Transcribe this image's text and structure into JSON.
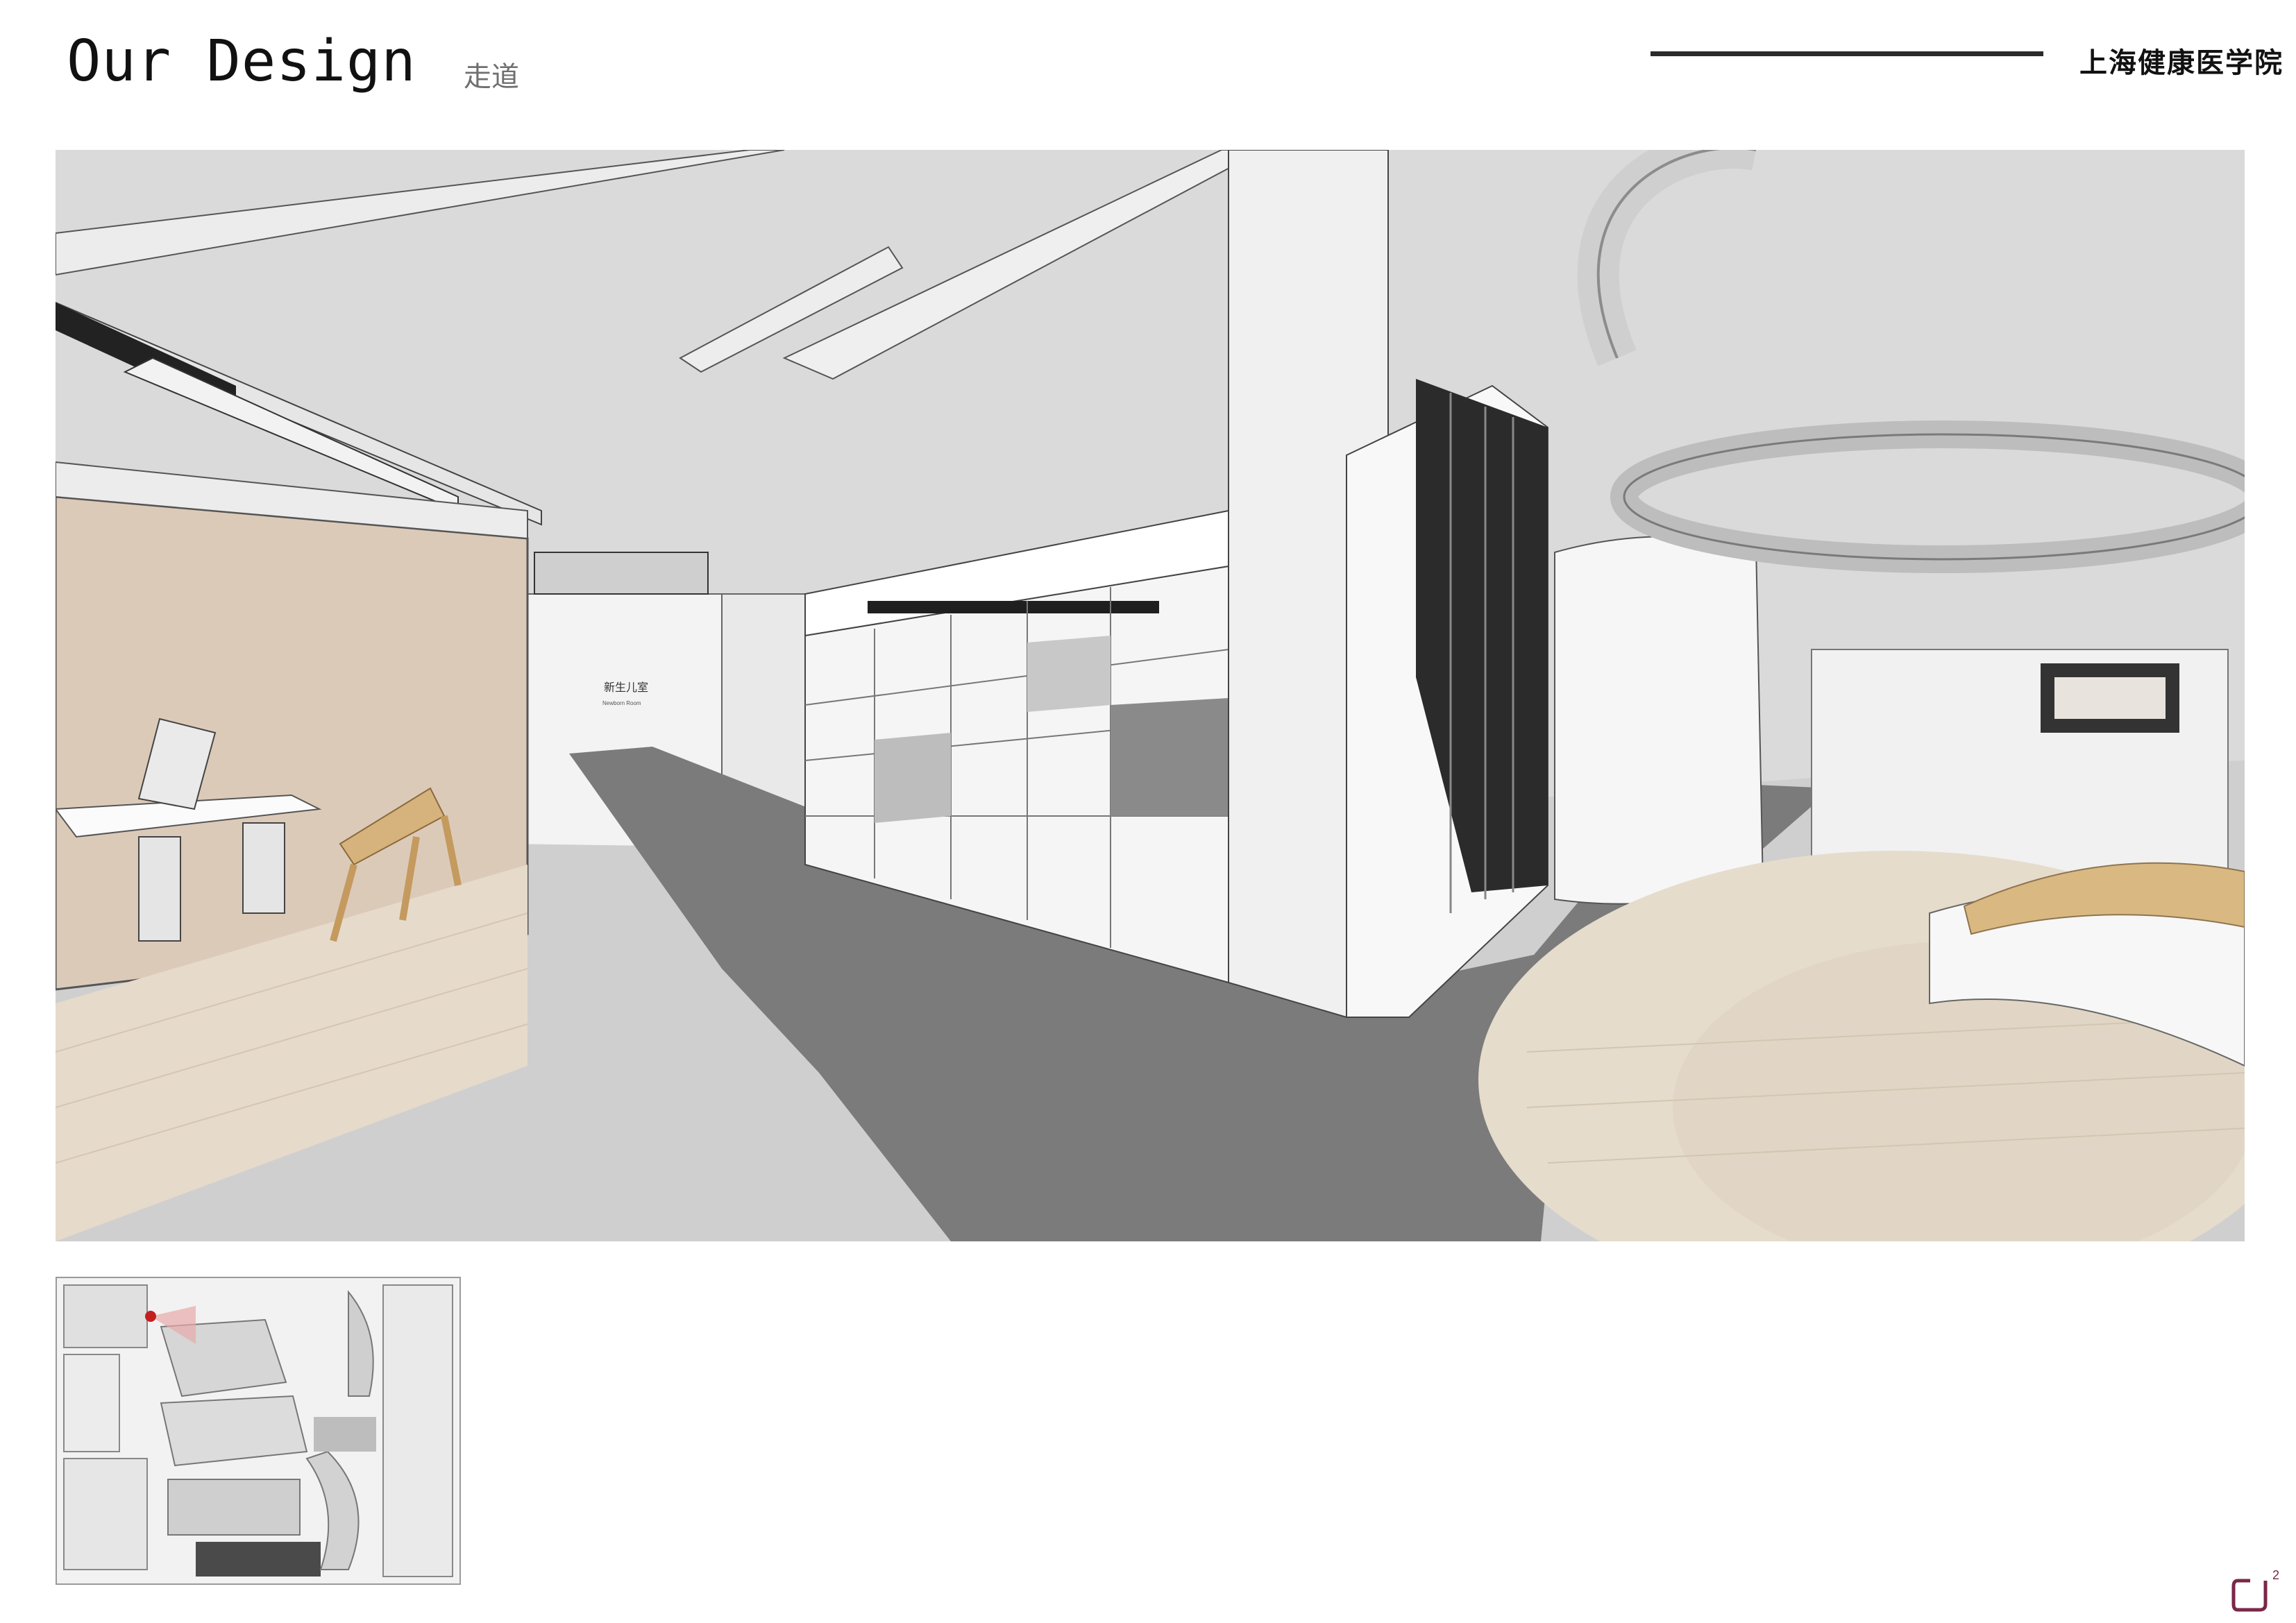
{
  "header": {
    "title": "Our Design",
    "subtitle": "走道",
    "institution": "上海健康医学院"
  },
  "render": {
    "sign_room_cn": "新生儿室",
    "sign_room_en": "Newborn Room"
  },
  "colors": {
    "ceiling": "#d9d9d9",
    "wall": "#efefef",
    "floor_light": "#cfcfcf",
    "corridor_dark": "#7d7d7d",
    "wood": "#e6d9c7",
    "accent_wall": "#dcc8b9",
    "logo": "#7a2848"
  },
  "icons": {
    "logo": "brand-logo-icon",
    "location_marker": "location-marker-icon"
  }
}
